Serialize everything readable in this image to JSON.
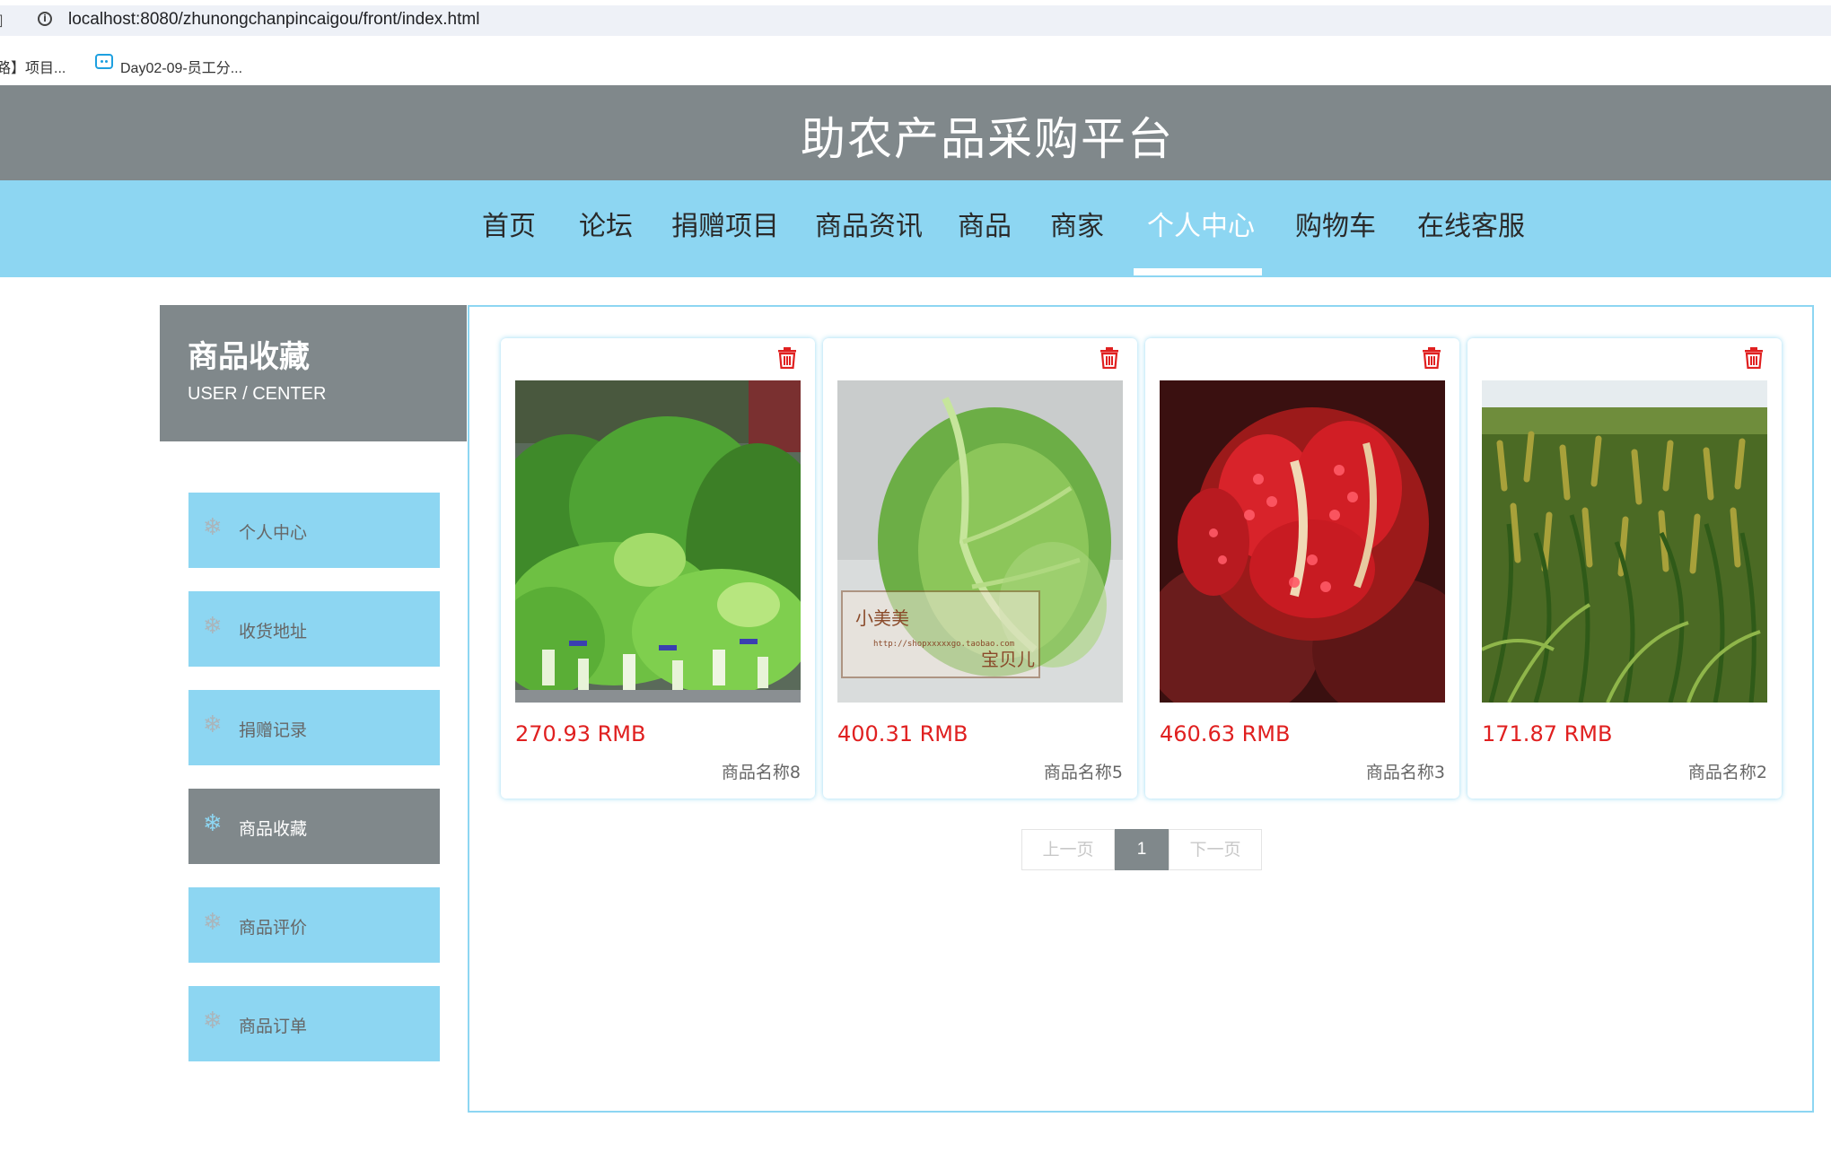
{
  "browser": {
    "url": "localhost:8080/zhunongchanpincaigou/front/index.html",
    "bookmarks": [
      "路】项目...",
      "Day02-09-员工分..."
    ]
  },
  "site": {
    "title": "助农产品采购平台"
  },
  "nav": {
    "items": [
      "首页",
      "论坛",
      "捐赠项目",
      "商品资讯",
      "商品",
      "商家",
      "个人中心",
      "购物车",
      "在线客服"
    ],
    "active": "个人中心"
  },
  "sidebar": {
    "title": "商品收藏",
    "subtitle": "USER / CENTER",
    "items": [
      {
        "label": "个人中心",
        "icon": "snowflake-icon"
      },
      {
        "label": "收货地址",
        "icon": "snowflake-icon"
      },
      {
        "label": "捐赠记录",
        "icon": "snowflake-icon"
      },
      {
        "label": "商品收藏",
        "icon": "snowflake-icon",
        "active": true
      },
      {
        "label": "商品评价",
        "icon": "snowflake-icon"
      },
      {
        "label": "商品订单",
        "icon": "snowflake-icon"
      }
    ]
  },
  "favorites": [
    {
      "price": "270.93 RMB",
      "name": "商品名称8",
      "image": "leafy-greens-photo"
    },
    {
      "price": "400.31 RMB",
      "name": "商品名称5",
      "image": "cabbage-photo",
      "watermark": [
        "小美美",
        "宝贝儿",
        "http://shopxxxxxgo.taobao.com"
      ]
    },
    {
      "price": "460.63 RMB",
      "name": "商品名称3",
      "image": "pomegranate-photo"
    },
    {
      "price": "171.87 RMB",
      "name": "商品名称2",
      "image": "millet-field-photo"
    }
  ],
  "pager": {
    "prev": "上一页",
    "current": "1",
    "next": "下一页"
  },
  "colors": {
    "header_gray": "#80888b",
    "nav_blue": "#8dd6f2",
    "price_red": "#e02020"
  }
}
